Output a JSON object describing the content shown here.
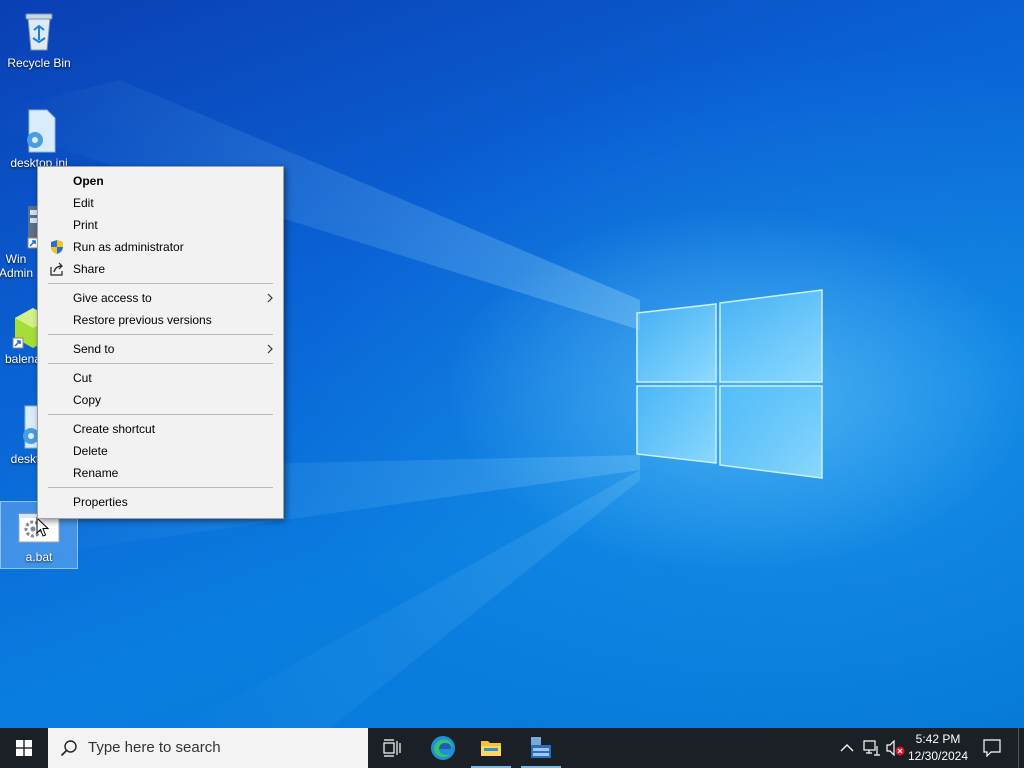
{
  "desktop": {
    "icons": [
      {
        "label": "Recycle Bin"
      },
      {
        "label": "desktop.ini"
      },
      {
        "label": "Windows Admin"
      },
      {
        "label": "balena"
      },
      {
        "label": "desktop.ini"
      },
      {
        "label": "a.bat"
      }
    ],
    "icon_labels_visible": [
      "Recycle Bin",
      "desktop.ini",
      "Win",
      "Admin",
      "balena",
      "deskt",
      "a.bat"
    ]
  },
  "context_menu": {
    "items": [
      {
        "label": "Open",
        "bold": true
      },
      {
        "label": "Edit"
      },
      {
        "label": "Print"
      },
      {
        "label": "Run as administrator",
        "icon": "uac-shield-icon"
      },
      {
        "label": "Share",
        "icon": "share-icon"
      },
      {
        "label": "Give access to",
        "submenu": true
      },
      {
        "label": "Restore previous versions"
      },
      {
        "label": "Send to",
        "submenu": true
      },
      {
        "label": "Cut"
      },
      {
        "label": "Copy"
      },
      {
        "label": "Create shortcut"
      },
      {
        "label": "Delete"
      },
      {
        "label": "Rename"
      },
      {
        "label": "Properties"
      }
    ]
  },
  "taskbar": {
    "search_placeholder": "Type here to search",
    "clock_time": "5:42 PM",
    "clock_date": "12/30/2024",
    "pinned": [
      "task-view-icon",
      "edge-icon",
      "file-explorer-icon",
      "server-manager-icon"
    ],
    "accent_color": "#76b9ed"
  },
  "colors": {
    "taskbar_bg": "#1b1f26",
    "menu_bg": "#f2f2f2",
    "wallpaper_primary": "#0a6fd8"
  }
}
